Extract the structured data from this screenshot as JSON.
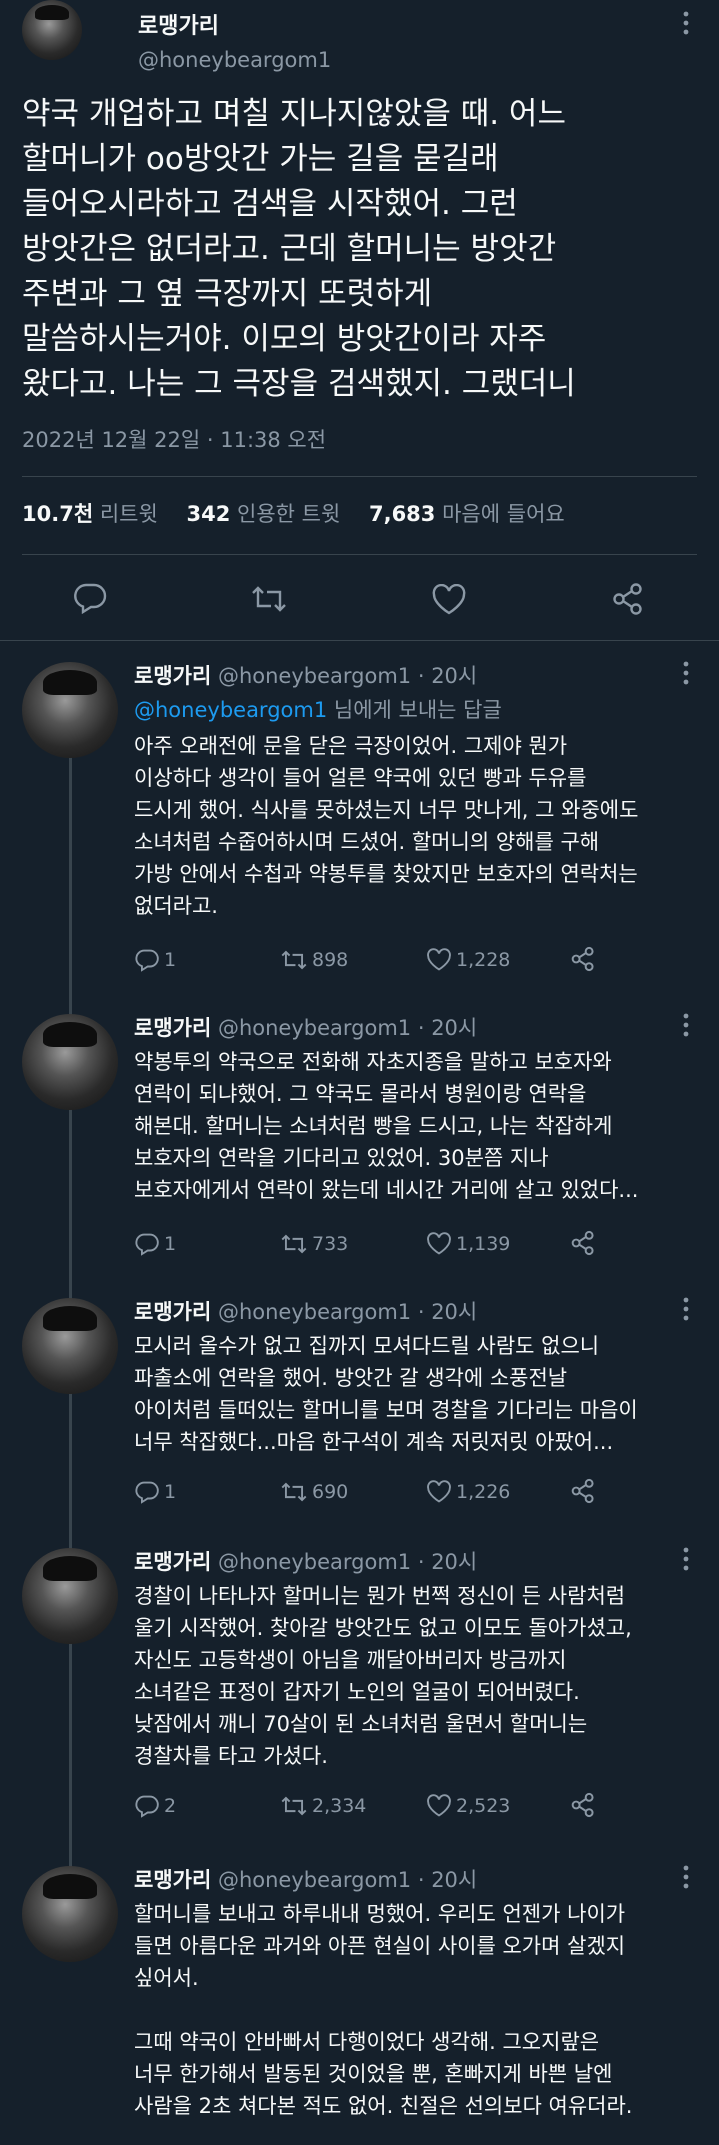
{
  "main_tweet": {
    "display_name": "로맹가리",
    "handle": "@honeybeargom1",
    "lines": [
      "약국 개업하고 며칠 지나지않았을 때. 어느",
      "할머니가 oo방앗간 가는 길을 묻길래",
      "들어오시라하고 검색을 시작했어. 그런",
      "방앗간은 없더라고. 근데 할머니는 방앗간",
      "주변과 그 옆 극장까지 또렷하게",
      "말씀하시는거야. 이모의 방앗간이라 자주",
      "왔다고. 나는 그 극장을 검색했지. 그랬더니"
    ],
    "timestamp": "2022년 12월 22일 · 11:38 오전",
    "retweets": "10.7천",
    "retweets_label": "리트윗",
    "quotes": "342",
    "quotes_label": "인용한 트윗",
    "likes": "7,683",
    "likes_label": "마음에 들어요",
    "icons": [
      "reply-icon",
      "retweet-icon",
      "like-icon",
      "share-icon"
    ]
  },
  "replies": [
    {
      "display_name": "로맹가리",
      "handle_time": "@honeybeargom1 · 20시",
      "reply_to_user": "@honeybeargom1",
      "reply_to_suffix": " 님에게 보내는 답글",
      "lines": [
        "아주 오래전에 문을 닫은 극장이었어. 그제야 뭔가",
        "이상하다 생각이 들어 얼른 약국에 있던 빵과 두유를",
        "드시게 했어. 식사를 못하셨는지 너무 맛나게, 그 와중에도",
        "소녀처럼 수줍어하시며 드셨어. 할머니의 양해를 구해",
        "가방 안에서 수첩과 약봉투를 찾았지만 보호자의 연락처는",
        "없더라고."
      ],
      "replies_count": "1",
      "retweets_count": "898",
      "likes_count": "1,228"
    },
    {
      "display_name": "로맹가리",
      "handle_time": "@honeybeargom1 · 20시",
      "lines": [
        "약봉투의 약국으로 전화해 자초지종을 말하고 보호자와",
        "연락이 되냐했어. 그 약국도 몰라서 병원이랑 연락을",
        "해본대. 할머니는 소녀처럼 빵을 드시고, 나는 착잡하게",
        "보호자의 연락을 기다리고 있었어. 30분쯤 지나",
        "보호자에게서 연락이 왔는데 네시간 거리에 살고 있었다..."
      ],
      "replies_count": "1",
      "retweets_count": "733",
      "likes_count": "1,139"
    },
    {
      "display_name": "로맹가리",
      "handle_time": "@honeybeargom1 · 20시",
      "lines": [
        "모시러 올수가 없고 집까지 모셔다드릴 사람도 없으니",
        "파출소에 연락을 했어. 방앗간 갈 생각에 소풍전날",
        "아이처럼 들떠있는 할머니를 보며 경찰을 기다리는 마음이",
        "너무 착잡했다...마음 한구석이 계속 저릿저릿 아팠어..."
      ],
      "replies_count": "1",
      "retweets_count": "690",
      "likes_count": "1,226"
    },
    {
      "display_name": "로맹가리",
      "handle_time": "@honeybeargom1 · 20시",
      "lines": [
        "경찰이 나타나자 할머니는 뭔가 번쩍 정신이 든 사람처럼",
        "울기 시작했어. 찾아갈 방앗간도 없고 이모도 돌아가셨고,",
        "자신도 고등학생이 아님을 깨달아버리자 방금까지",
        "소녀같은 표정이 갑자기 노인의 얼굴이 되어버렸다.",
        "낮잠에서 깨니 70살이 된 소녀처럼 울면서 할머니는",
        "경찰차를 타고 가셨다."
      ],
      "replies_count": "2",
      "retweets_count": "2,334",
      "likes_count": "2,523"
    },
    {
      "display_name": "로맹가리",
      "handle_time": "@honeybeargom1 · 20시",
      "lines": [
        "할머니를 보내고 하루내내 멍했어. 우리도 언젠가 나이가",
        "들면 아름다운 과거와 아픈 현실이 사이를 오가며 살겠지",
        "싶어서.",
        "",
        "그때 약국이 안바빠서 다행이었다 생각해. 그오지랖은",
        "너무 한가해서 발동된 것이었을 뿐, 혼빠지게 바쁜 날엔",
        "사람을 2초 쳐다본 적도 없어. 친절은 선의보다 여유더라."
      ]
    }
  ],
  "colors": {
    "background": "#15202b",
    "text": "#f7f9f9",
    "secondary": "#8b98a5",
    "link": "#1d9bf0",
    "divider": "#38444d"
  }
}
